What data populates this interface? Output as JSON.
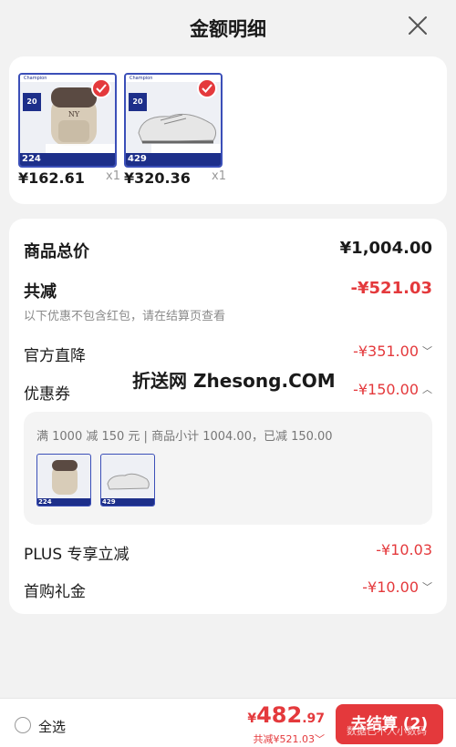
{
  "header": {
    "title": "金额明细"
  },
  "products": [
    {
      "brand": "Champion",
      "size_tag": "20",
      "strip_label": "224",
      "price": "¥162.61",
      "qty": "x1"
    },
    {
      "brand": "Champion",
      "size_tag": "20",
      "strip_label": "429",
      "price": "¥320.36",
      "qty": "x1"
    }
  ],
  "summary": {
    "total_label": "商品总价",
    "total_value": "¥1,004.00",
    "discount_label": "共减",
    "discount_value": "-¥521.03",
    "note": "以下优惠不包含红包，请在结算页查看"
  },
  "lines": [
    {
      "label": "官方直降",
      "value": "-¥351.00",
      "chevron": "﹀"
    },
    {
      "label": "优惠券",
      "value": "-¥150.00",
      "chevron": "︿"
    }
  ],
  "coupon_box": {
    "text": "满 1000 减 150 元 | 商品小计 1004.00，已减 150.00",
    "items": [
      {
        "strip_label": "224"
      },
      {
        "strip_label": "429"
      }
    ]
  },
  "extra_lines": [
    {
      "label": "PLUS 专享立减",
      "value": "-¥10.03",
      "chevron": ""
    },
    {
      "label": "首购礼金",
      "value": "-¥10.00",
      "chevron": "﹀"
    }
  ],
  "watermark": "折送网 Zhesong.COM",
  "footer": {
    "select_all": "全选",
    "currency": "¥",
    "amount_int": "482",
    "amount_dec": ".97",
    "saved": "共减¥521.03﹀",
    "checkout_label": "去结算 (2)",
    "overlay_text": "数据已不入小数码"
  },
  "colors": {
    "accent": "#e4393c",
    "brand_blue": "#1d2f8a"
  }
}
